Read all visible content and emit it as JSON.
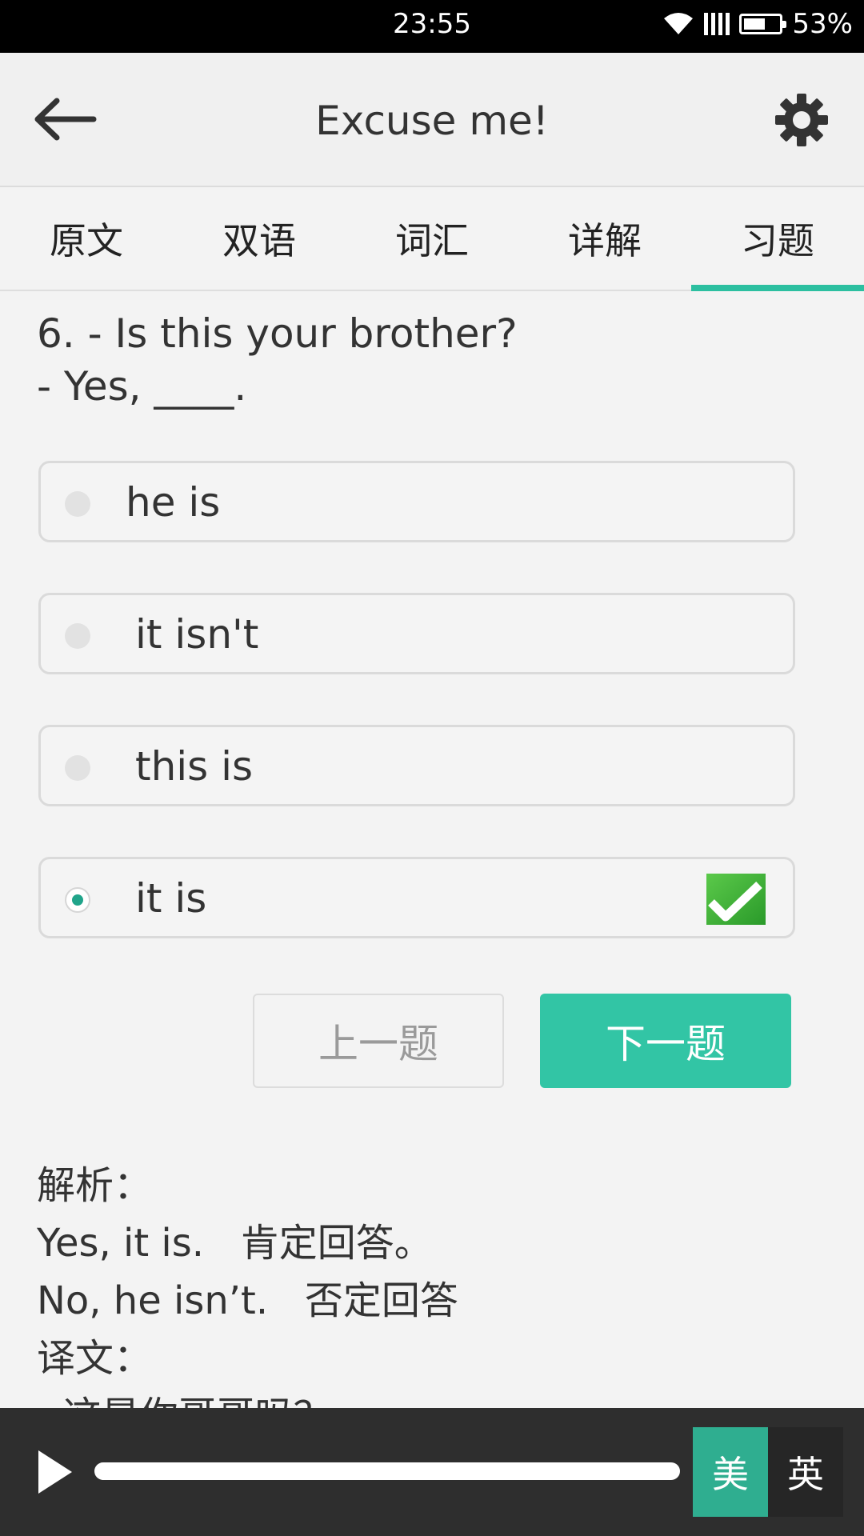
{
  "status_bar": {
    "time": "23:55",
    "battery": "53%"
  },
  "app_bar": {
    "title": "Excuse me!"
  },
  "tabs": [
    {
      "label": "原文"
    },
    {
      "label": "双语"
    },
    {
      "label": "词汇"
    },
    {
      "label": "详解"
    },
    {
      "label": "习题",
      "active": true
    }
  ],
  "question": {
    "line1": "6. - Is this your brother?",
    "line2": "- Yes, ____."
  },
  "options": [
    {
      "text": "he is",
      "selected": false
    },
    {
      "text": "it isn't",
      "selected": false
    },
    {
      "text": "this is",
      "selected": false
    },
    {
      "text": "it is",
      "selected": true,
      "correct": true
    }
  ],
  "buttons": {
    "prev": "上一题",
    "next": "下一题"
  },
  "analysis": {
    "lines": [
      "解析：",
      "Yes, it is.   肯定回答。",
      "No, he isn’t.   否定回答",
      "译文：",
      "- 这是你哥哥吗？"
    ]
  },
  "player": {
    "accent_us": "美",
    "accent_uk": "英"
  },
  "colors": {
    "accent": "#2cbfa0",
    "next_button": "#32c5a5",
    "check_green": "#3cb034"
  }
}
